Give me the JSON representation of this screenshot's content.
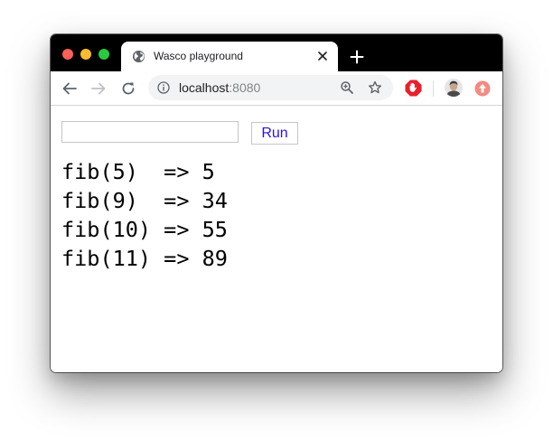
{
  "browser": {
    "tab": {
      "title": "Wasco playground",
      "favicon": "globe-icon"
    },
    "address_bar": {
      "host": "localhost",
      "port": ":8080"
    },
    "icons": {
      "back": "back-arrow-icon",
      "forward": "forward-arrow-icon",
      "reload": "reload-icon",
      "info": "info-icon",
      "zoom": "zoom-icon",
      "bookmark": "star-icon",
      "extension": "stop-hand-icon",
      "profile": "avatar",
      "update": "update-arrow-icon"
    },
    "colors": {
      "titlebar": "#000000",
      "omnibox": "#f1f3f4",
      "extension_red": "#e8202a",
      "update_badge": "#f28b82"
    }
  },
  "page": {
    "input": {
      "value": "",
      "placeholder": ""
    },
    "run_label": "Run",
    "run_color": "#2a12e6",
    "output": [
      "fib(5)  => 5",
      "fib(9)  => 34",
      "fib(10) => 55",
      "fib(11) => 89"
    ]
  }
}
